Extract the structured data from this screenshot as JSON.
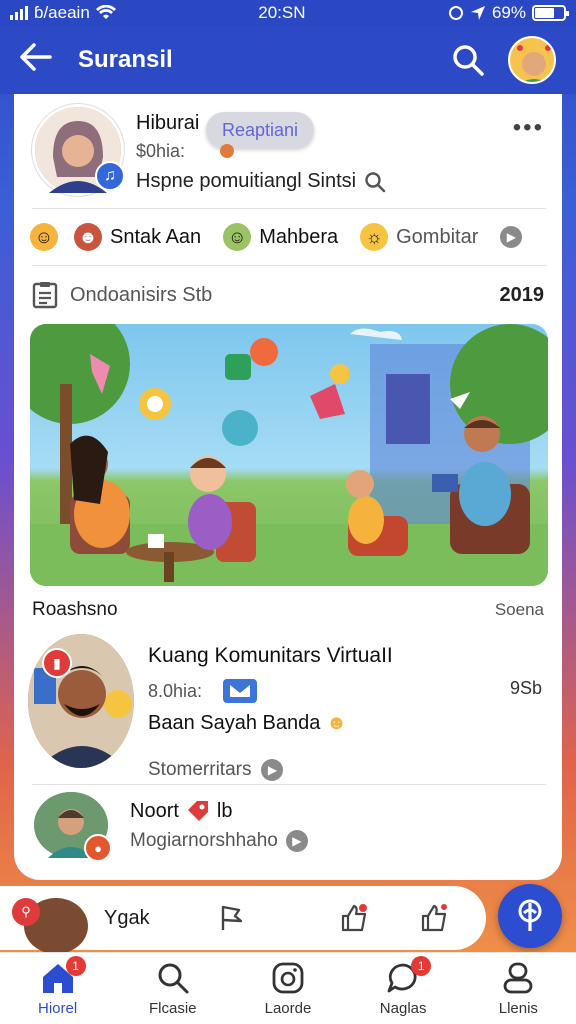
{
  "status_bar": {
    "carrier": "ɓ/aeain",
    "time": "20:SN",
    "battery": "69%",
    "battery_level": 0.69
  },
  "app_bar": {
    "title": "Suransil"
  },
  "post": {
    "name": "Hiburai",
    "time": "$0hia:",
    "subtitle": "Hspne pomuitiangl Sintsi",
    "tooltip": "Reaptiani",
    "more": "•••"
  },
  "reactions": [
    {
      "icon": "mask-icon",
      "label": ""
    },
    {
      "icon": "face-icon",
      "label": "Sntak Aan"
    },
    {
      "icon": "person-icon",
      "label": "Mahbera"
    },
    {
      "icon": "sun-icon",
      "label": "Gombitar"
    }
  ],
  "document": {
    "label": "Ondoanisirs Stb",
    "date": "2019"
  },
  "section": {
    "left": "Roashsno",
    "right": "Soena"
  },
  "feature": {
    "title": "Kuang Komunitars VirtuaII",
    "time": "8.0hia:",
    "count": "9Sb",
    "subtitle": "Baan Sayah Banda",
    "comments": "Stomerritars"
  },
  "notification": {
    "title": "Noort",
    "tag": "lb",
    "subtitle": "Mogiarnorshhaho"
  },
  "composer": {
    "name": "Ygak"
  },
  "bottom_nav": [
    {
      "label": "Hiorel",
      "icon": "home-icon",
      "badge": "1",
      "active": true
    },
    {
      "label": "Flcasie",
      "icon": "search-icon",
      "badge": "",
      "active": false
    },
    {
      "label": "Laorde",
      "icon": "camera-icon",
      "badge": "",
      "active": false
    },
    {
      "label": "Naglas",
      "icon": "chat-icon",
      "badge": "1",
      "active": false
    },
    {
      "label": "Llenis",
      "icon": "profile-icon",
      "badge": "",
      "active": false
    }
  ],
  "colors": {
    "primary": "#2d4ac6",
    "accent_red": "#e53935",
    "card": "#ffffff"
  }
}
